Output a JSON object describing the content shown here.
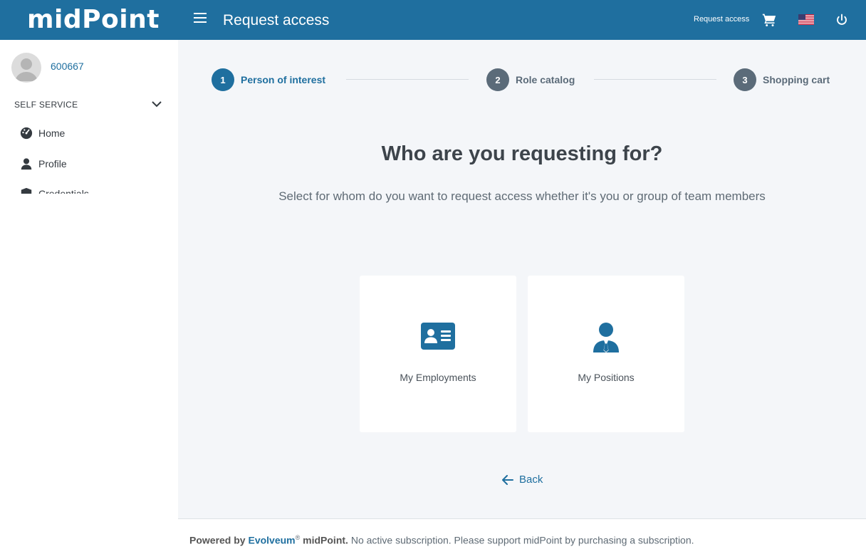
{
  "header": {
    "logo_text": "midPoint",
    "title": "Request access",
    "request_access_link": "Request access",
    "icons": [
      "menu-icon",
      "cart-icon",
      "us-flag-icon",
      "power-icon"
    ]
  },
  "sidebar": {
    "username": "600667",
    "section_label": "SELF SERVICE",
    "items": [
      {
        "label": "Home",
        "icon": "dashboard-icon"
      },
      {
        "label": "Profile",
        "icon": "user-icon"
      },
      {
        "label": "Credentials",
        "icon": "shield-icon"
      }
    ]
  },
  "stepper": {
    "steps": [
      {
        "number": "1",
        "label": "Person of interest",
        "state": "active"
      },
      {
        "number": "2",
        "label": "Role catalog",
        "state": "idle"
      },
      {
        "number": "3",
        "label": "Shopping cart",
        "state": "idle"
      }
    ]
  },
  "main": {
    "title": "Who are you requesting for?",
    "subtitle": "Select for whom do you want to request access whether it's you or group of team members",
    "tiles": [
      {
        "label": "My Employments",
        "icon": "id-card-icon"
      },
      {
        "label": "My Positions",
        "icon": "user-tie-icon"
      }
    ],
    "back_label": "Back"
  },
  "footer": {
    "powered_by": "Powered by",
    "brand": "Evolveum",
    "registered": "®",
    "product": "midPoint.",
    "message": "No active subscription. Please support midPoint by purchasing a subscription."
  },
  "colors": {
    "primary": "#1f6f9f",
    "background": "#f4f6f9",
    "step_idle": "#5b6b79"
  }
}
